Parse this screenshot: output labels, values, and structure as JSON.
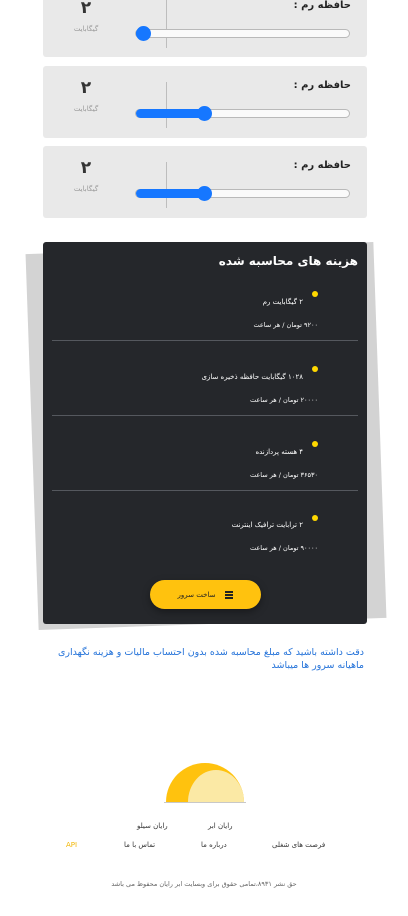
{
  "ram_cards": [
    {
      "label": "حافظه رم :",
      "value": "۲",
      "unit": "گیگابایت",
      "fill_fraction": 0.0
    },
    {
      "label": "حافظه رم :",
      "value": "۲",
      "unit": "گیگابایت",
      "fill_fraction": 0.31
    },
    {
      "label": "حافظه رم :",
      "value": "۲",
      "unit": "گیگابایت",
      "fill_fraction": 0.31
    }
  ],
  "cost": {
    "title": "هزینه های محاسبه شده",
    "items": [
      {
        "name": "۲ گیگابایت رم",
        "price": "۹۲۰۰ تومان / هر ساعت"
      },
      {
        "name": "۱۰۲۸ گیگابایت حافظه ذخیره سازی",
        "price": "۲۰۰۰۰ تومان / هر ساعت"
      },
      {
        "name": "۴ هسته پردازنده",
        "price": "۳۶۵۳۰ تومان / هر ساعت"
      },
      {
        "name": "۲ ترابایت ترافیک اینترنت",
        "price": "۹۰۰۰۰ تومان / هر ساعت"
      }
    ],
    "build_button": "ساخت سرور",
    "button_icon": "server-icon"
  },
  "note": "دقت داشته باشید که مبلغ محاسبه شده بدون احتساب مالیات و هزینه نگهداری ماهیانه سرور ها میباشد",
  "footer": {
    "row1": [
      "رایان ابر",
      "رایان سیلو"
    ],
    "row2": [
      "فرصت های شغلی",
      "درباره ما",
      "تماس با ما",
      "API"
    ],
    "copyright": "حق نشر ۸۹۳۱،تمامی حقوق برای وبسایت ابر رایان محفوظ می باشد"
  },
  "colors": {
    "accent": "#1677ff",
    "yellow": "#ffc20e",
    "panel": "#25272b",
    "note": "#2573d9"
  }
}
